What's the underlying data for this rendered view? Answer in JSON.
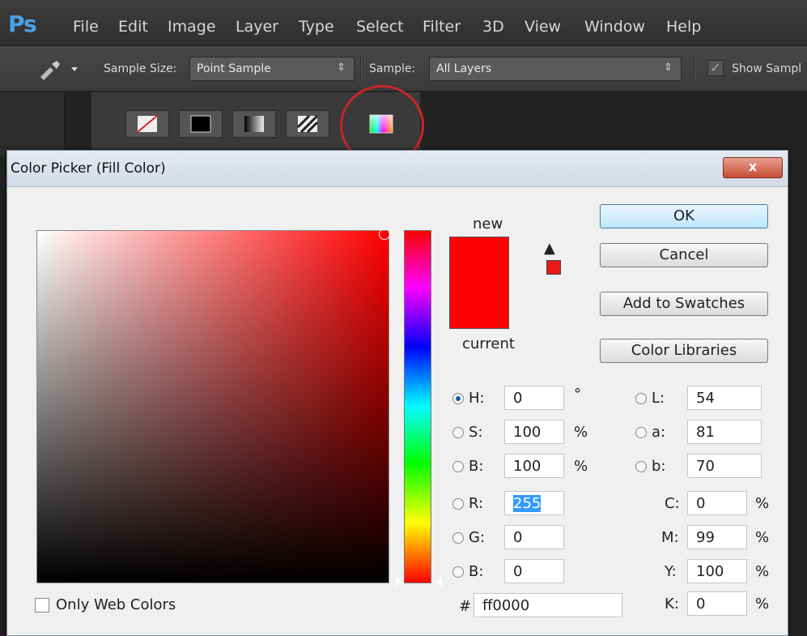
{
  "app": {
    "logo": "Ps"
  },
  "menu": [
    "File",
    "Edit",
    "Image",
    "Layer",
    "Type",
    "Select",
    "Filter",
    "3D",
    "View",
    "Window",
    "Help"
  ],
  "options": {
    "sample_size_label": "Sample Size:",
    "sample_size_value": "Point Sample",
    "sample_label": "Sample:",
    "sample_value": "All Layers",
    "show_sampling": "Show Sampl"
  },
  "dialog": {
    "title": "Color Picker (Fill Color)",
    "close": "x",
    "new_label": "new",
    "current_label": "current",
    "new_color": "#ff0000",
    "buttons": {
      "ok": "OK",
      "cancel": "Cancel",
      "add_swatches": "Add to Swatches",
      "libraries": "Color Libraries"
    },
    "hsb": [
      {
        "label": "H:",
        "value": "0",
        "unit": "°",
        "selected": true
      },
      {
        "label": "S:",
        "value": "100",
        "unit": "%"
      },
      {
        "label": "B:",
        "value": "100",
        "unit": "%"
      }
    ],
    "rgb": [
      {
        "label": "R:",
        "value": "255"
      },
      {
        "label": "G:",
        "value": "0"
      },
      {
        "label": "B:",
        "value": "0"
      }
    ],
    "lab": [
      {
        "label": "L:",
        "value": "54"
      },
      {
        "label": "a:",
        "value": "81"
      },
      {
        "label": "b:",
        "value": "70"
      }
    ],
    "cmyk": [
      {
        "label": "C:",
        "value": "0",
        "unit": "%"
      },
      {
        "label": "M:",
        "value": "99",
        "unit": "%"
      },
      {
        "label": "Y:",
        "value": "100",
        "unit": "%"
      },
      {
        "label": "K:",
        "value": "0",
        "unit": "%"
      }
    ],
    "hex_label": "#",
    "hex_value": "ff0000",
    "web_colors": "Only Web Colors"
  }
}
